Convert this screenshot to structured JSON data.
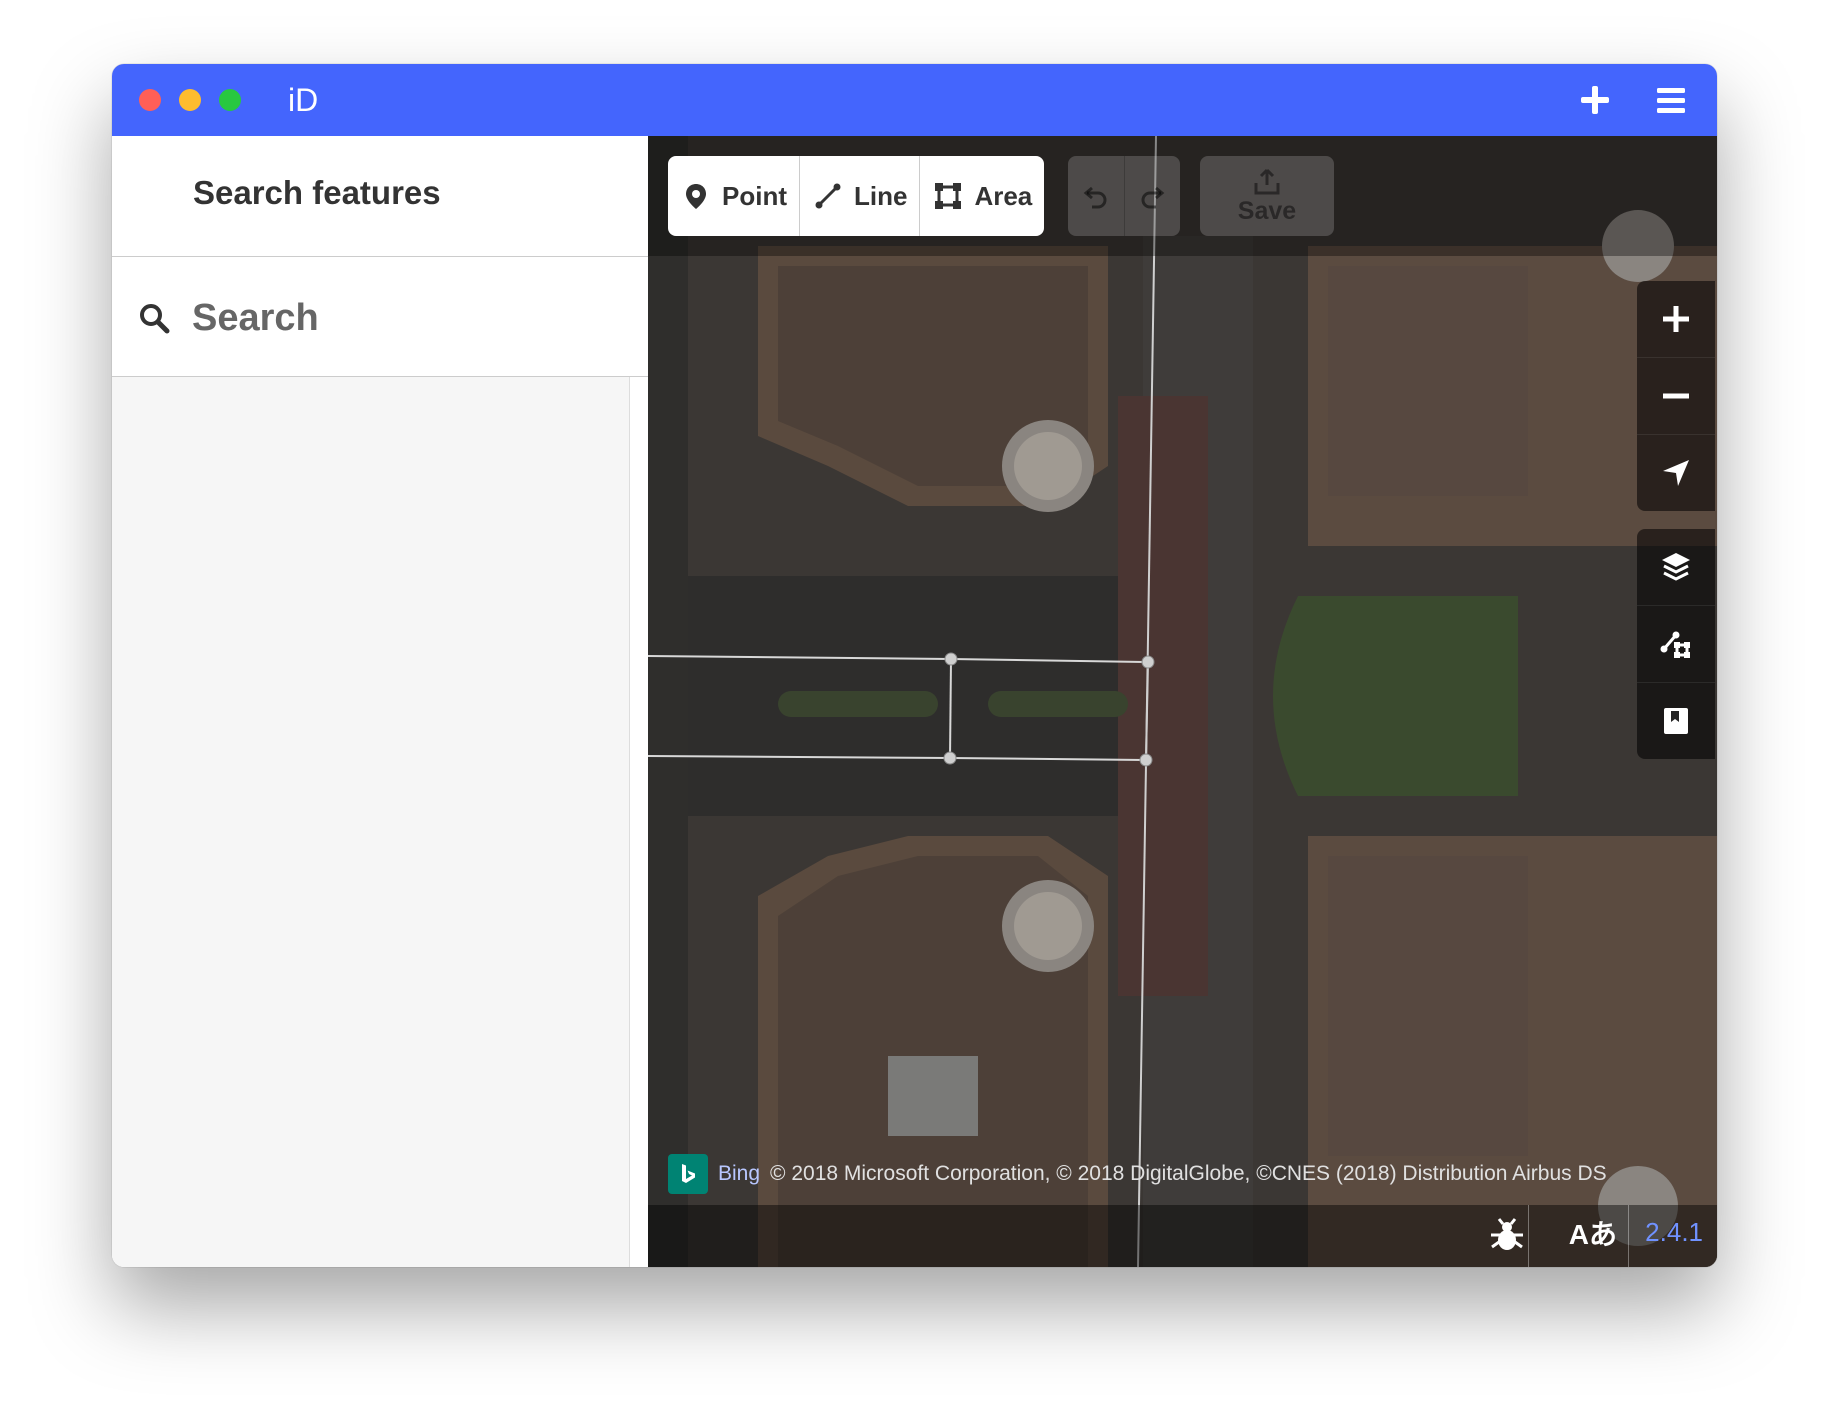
{
  "window": {
    "title": "iD"
  },
  "titlebar": {
    "add_icon": "plus-icon",
    "menu_icon": "hamburger-menu-icon"
  },
  "sidebar": {
    "header_title": "Search features",
    "search": {
      "placeholder": "Search",
      "value": "",
      "icon": "search-icon"
    }
  },
  "toolbar": {
    "modes": [
      {
        "label": "Point",
        "icon": "map-marker-icon"
      },
      {
        "label": "Line",
        "icon": "line-icon"
      },
      {
        "label": "Area",
        "icon": "area-icon"
      }
    ],
    "undo_icon": "undo-icon",
    "redo_icon": "redo-icon",
    "save_label": "Save",
    "save_icon": "upload-icon"
  },
  "map_controls": {
    "zoom_in_icon": "plus-icon",
    "zoom_out_icon": "minus-icon",
    "geolocate_icon": "location-arrow-icon",
    "background_icon": "layers-icon",
    "map_data_icon": "map-data-icon",
    "help_icon": "help-book-icon"
  },
  "attribution": {
    "provider": "Bing",
    "text": "© 2018 Microsoft Corporation, © 2018 DigitalGlobe, ©CNES (2018) Distribution Airbus DS"
  },
  "footer": {
    "issues_icon": "bug-icon",
    "language_label": "Aあ",
    "version": "2.4.1"
  },
  "colors": {
    "titlebar": "#4465fd",
    "version_link": "#7092ff",
    "bing_logo": "#008373"
  }
}
